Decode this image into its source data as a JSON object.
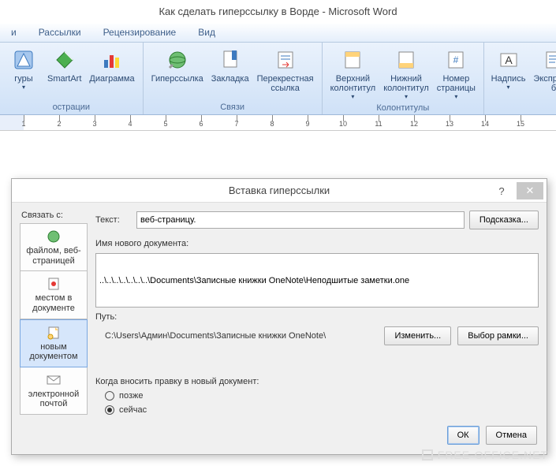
{
  "window": {
    "title": "Как сделать гиперссылку в Ворде - Microsoft Word"
  },
  "tabs": [
    "и",
    "Рассылки",
    "Рецензирование",
    "Вид"
  ],
  "ribbon": {
    "groups": [
      {
        "caption": "острации",
        "items": [
          {
            "label": "гуры"
          },
          {
            "label": "SmartArt"
          },
          {
            "label": "Диаграмма"
          }
        ]
      },
      {
        "caption": "Связи",
        "items": [
          {
            "label": "Гиперссылка"
          },
          {
            "label": "Закладка"
          },
          {
            "label": "Перекрестная\nссылка"
          }
        ]
      },
      {
        "caption": "Колонтитулы",
        "items": [
          {
            "label": "Верхний\nколонтитул"
          },
          {
            "label": "Нижний\nколонтитул"
          },
          {
            "label": "Номер\nстраницы"
          }
        ]
      },
      {
        "caption": "",
        "items": [
          {
            "label": "Надпись"
          },
          {
            "label": "Экспресс-б"
          }
        ]
      }
    ]
  },
  "ruler": {
    "start": 1,
    "end": 15
  },
  "dialog": {
    "title": "Вставка гиперссылки",
    "link_label": "Связать с:",
    "link_opts": [
      "файлом, веб-\nстраницей",
      "местом в\nдокументе",
      "новым\nдокументом",
      "электронной\nпочтой"
    ],
    "text_label": "Текст:",
    "text_value": "веб-страницу.",
    "hint_btn": "Подсказка...",
    "newdoc_label": "Имя нового документа:",
    "newdoc_value": "..\\..\\..\\..\\..\\..\\..\\Documents\\Записные книжки OneNote\\Неподшитые заметки.one",
    "path_label": "Путь:",
    "path_value": "C:\\Users\\Админ\\Documents\\Записные книжки OneNote\\",
    "change_btn": "Изменить...",
    "frame_btn": "Выбор рамки...",
    "when_label": "Когда вносить правку в новый документ:",
    "radio_later": "позже",
    "radio_now": "сейчас",
    "ok": "ОК",
    "cancel": "Отмена"
  },
  "watermark": "FREE-OFFICE.NET"
}
